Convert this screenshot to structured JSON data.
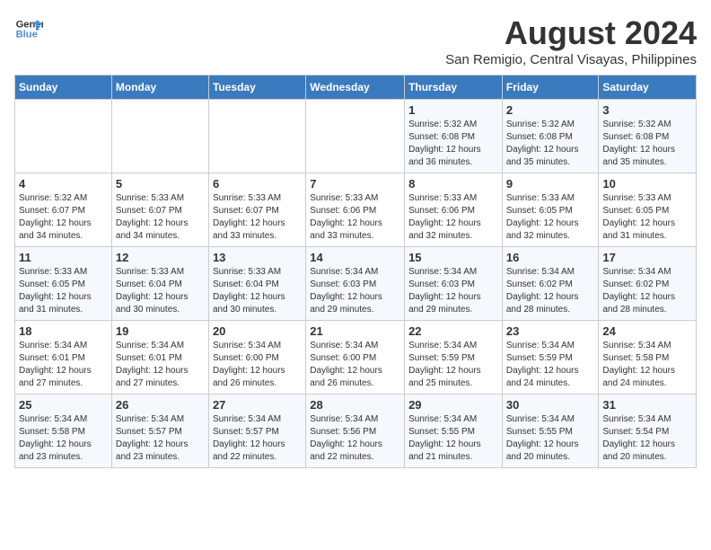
{
  "logo": {
    "line1": "General",
    "line2": "Blue"
  },
  "title": "August 2024",
  "subtitle": "San Remigio, Central Visayas, Philippines",
  "days_of_week": [
    "Sunday",
    "Monday",
    "Tuesday",
    "Wednesday",
    "Thursday",
    "Friday",
    "Saturday"
  ],
  "weeks": [
    [
      {
        "day": "",
        "info": ""
      },
      {
        "day": "",
        "info": ""
      },
      {
        "day": "",
        "info": ""
      },
      {
        "day": "",
        "info": ""
      },
      {
        "day": "1",
        "info": "Sunrise: 5:32 AM\nSunset: 6:08 PM\nDaylight: 12 hours\nand 36 minutes."
      },
      {
        "day": "2",
        "info": "Sunrise: 5:32 AM\nSunset: 6:08 PM\nDaylight: 12 hours\nand 35 minutes."
      },
      {
        "day": "3",
        "info": "Sunrise: 5:32 AM\nSunset: 6:08 PM\nDaylight: 12 hours\nand 35 minutes."
      }
    ],
    [
      {
        "day": "4",
        "info": "Sunrise: 5:32 AM\nSunset: 6:07 PM\nDaylight: 12 hours\nand 34 minutes."
      },
      {
        "day": "5",
        "info": "Sunrise: 5:33 AM\nSunset: 6:07 PM\nDaylight: 12 hours\nand 34 minutes."
      },
      {
        "day": "6",
        "info": "Sunrise: 5:33 AM\nSunset: 6:07 PM\nDaylight: 12 hours\nand 33 minutes."
      },
      {
        "day": "7",
        "info": "Sunrise: 5:33 AM\nSunset: 6:06 PM\nDaylight: 12 hours\nand 33 minutes."
      },
      {
        "day": "8",
        "info": "Sunrise: 5:33 AM\nSunset: 6:06 PM\nDaylight: 12 hours\nand 32 minutes."
      },
      {
        "day": "9",
        "info": "Sunrise: 5:33 AM\nSunset: 6:05 PM\nDaylight: 12 hours\nand 32 minutes."
      },
      {
        "day": "10",
        "info": "Sunrise: 5:33 AM\nSunset: 6:05 PM\nDaylight: 12 hours\nand 31 minutes."
      }
    ],
    [
      {
        "day": "11",
        "info": "Sunrise: 5:33 AM\nSunset: 6:05 PM\nDaylight: 12 hours\nand 31 minutes."
      },
      {
        "day": "12",
        "info": "Sunrise: 5:33 AM\nSunset: 6:04 PM\nDaylight: 12 hours\nand 30 minutes."
      },
      {
        "day": "13",
        "info": "Sunrise: 5:33 AM\nSunset: 6:04 PM\nDaylight: 12 hours\nand 30 minutes."
      },
      {
        "day": "14",
        "info": "Sunrise: 5:34 AM\nSunset: 6:03 PM\nDaylight: 12 hours\nand 29 minutes."
      },
      {
        "day": "15",
        "info": "Sunrise: 5:34 AM\nSunset: 6:03 PM\nDaylight: 12 hours\nand 29 minutes."
      },
      {
        "day": "16",
        "info": "Sunrise: 5:34 AM\nSunset: 6:02 PM\nDaylight: 12 hours\nand 28 minutes."
      },
      {
        "day": "17",
        "info": "Sunrise: 5:34 AM\nSunset: 6:02 PM\nDaylight: 12 hours\nand 28 minutes."
      }
    ],
    [
      {
        "day": "18",
        "info": "Sunrise: 5:34 AM\nSunset: 6:01 PM\nDaylight: 12 hours\nand 27 minutes."
      },
      {
        "day": "19",
        "info": "Sunrise: 5:34 AM\nSunset: 6:01 PM\nDaylight: 12 hours\nand 27 minutes."
      },
      {
        "day": "20",
        "info": "Sunrise: 5:34 AM\nSunset: 6:00 PM\nDaylight: 12 hours\nand 26 minutes."
      },
      {
        "day": "21",
        "info": "Sunrise: 5:34 AM\nSunset: 6:00 PM\nDaylight: 12 hours\nand 26 minutes."
      },
      {
        "day": "22",
        "info": "Sunrise: 5:34 AM\nSunset: 5:59 PM\nDaylight: 12 hours\nand 25 minutes."
      },
      {
        "day": "23",
        "info": "Sunrise: 5:34 AM\nSunset: 5:59 PM\nDaylight: 12 hours\nand 24 minutes."
      },
      {
        "day": "24",
        "info": "Sunrise: 5:34 AM\nSunset: 5:58 PM\nDaylight: 12 hours\nand 24 minutes."
      }
    ],
    [
      {
        "day": "25",
        "info": "Sunrise: 5:34 AM\nSunset: 5:58 PM\nDaylight: 12 hours\nand 23 minutes."
      },
      {
        "day": "26",
        "info": "Sunrise: 5:34 AM\nSunset: 5:57 PM\nDaylight: 12 hours\nand 23 minutes."
      },
      {
        "day": "27",
        "info": "Sunrise: 5:34 AM\nSunset: 5:57 PM\nDaylight: 12 hours\nand 22 minutes."
      },
      {
        "day": "28",
        "info": "Sunrise: 5:34 AM\nSunset: 5:56 PM\nDaylight: 12 hours\nand 22 minutes."
      },
      {
        "day": "29",
        "info": "Sunrise: 5:34 AM\nSunset: 5:55 PM\nDaylight: 12 hours\nand 21 minutes."
      },
      {
        "day": "30",
        "info": "Sunrise: 5:34 AM\nSunset: 5:55 PM\nDaylight: 12 hours\nand 20 minutes."
      },
      {
        "day": "31",
        "info": "Sunrise: 5:34 AM\nSunset: 5:54 PM\nDaylight: 12 hours\nand 20 minutes."
      }
    ]
  ]
}
